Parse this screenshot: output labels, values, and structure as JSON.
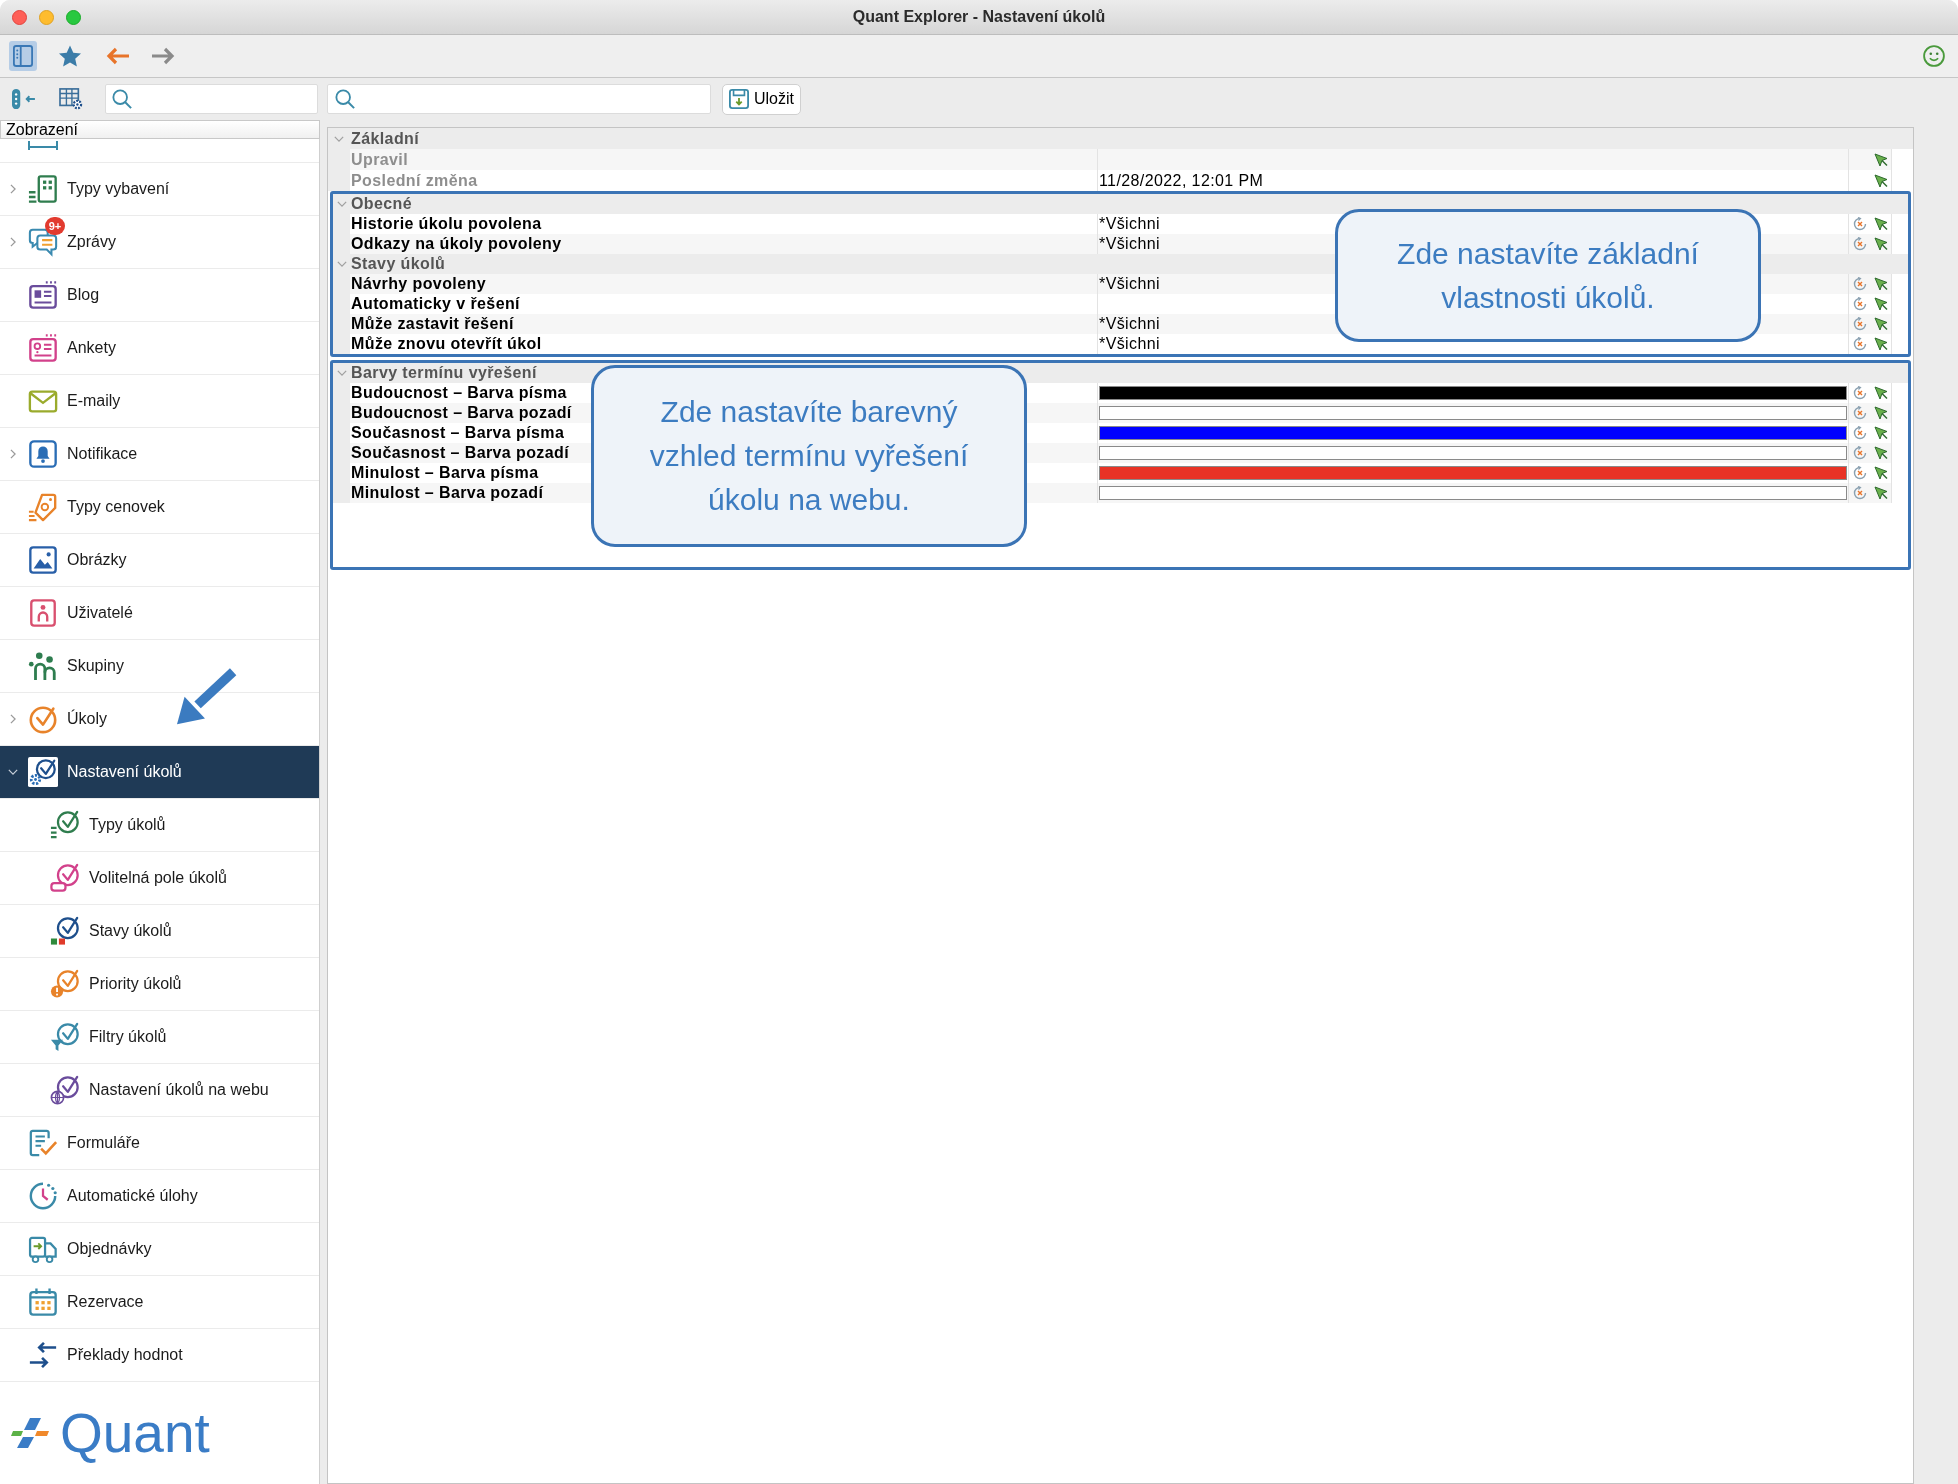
{
  "window": {
    "title": "Quant Explorer - Nastavení úkolů"
  },
  "toolbar": {
    "panel_toggle": {
      "selected": true
    }
  },
  "sidebar": {
    "header": "Zobrazení",
    "items": [
      {
        "label": "Typy vybavení",
        "expanded": false,
        "selected": false
      },
      {
        "label": "Zprávy",
        "expanded": false,
        "selected": false,
        "badge": "9+"
      },
      {
        "label": "Blog",
        "selected": false
      },
      {
        "label": "Ankety",
        "selected": false
      },
      {
        "label": "E-maily",
        "selected": false
      },
      {
        "label": "Notifikace",
        "expanded": false,
        "selected": false
      },
      {
        "label": "Typy cenovek",
        "selected": false
      },
      {
        "label": "Obrázky",
        "selected": false
      },
      {
        "label": "Uživatelé",
        "selected": false
      },
      {
        "label": "Skupiny",
        "selected": false
      },
      {
        "label": "Úkoly",
        "expanded": false,
        "selected": false
      },
      {
        "label": "Nastavení úkolů",
        "expanded": true,
        "selected": true,
        "children": [
          {
            "label": "Typy úkolů",
            "selected": false
          },
          {
            "label": "Volitelná pole úkolů",
            "selected": false
          },
          {
            "label": "Stavy úkolů",
            "selected": false
          },
          {
            "label": "Priority úkolů",
            "selected": false
          },
          {
            "label": "Filtry úkolů",
            "selected": false
          },
          {
            "label": "Nastavení úkolů na webu",
            "selected": false
          }
        ]
      },
      {
        "label": "Formuláře",
        "selected": false
      },
      {
        "label": "Automatické úlohy",
        "selected": false
      },
      {
        "label": "Objednávky",
        "selected": false
      },
      {
        "label": "Rezervace",
        "selected": false
      },
      {
        "label": "Překlady hodnot",
        "selected": false
      }
    ],
    "logo": "Quant"
  },
  "main": {
    "save_button": "Uložit"
  },
  "properties": {
    "sections": [
      {
        "highlighted": false,
        "groups": [
          {
            "title": "Základní",
            "expanded": true,
            "rows": [
              {
                "kind": "text",
                "label": "Upravil",
                "disabled": true,
                "resettable": false
              },
              {
                "kind": "text",
                "label": "Poslední změna",
                "value": "11/28/2022, 12:01 PM",
                "disabled": true,
                "resettable": false
              }
            ]
          }
        ]
      },
      {
        "highlighted": true,
        "callout_lines": [
          "Zde nastavíte základní",
          "vlastnosti úkolů."
        ],
        "groups": [
          {
            "title": "Obecné",
            "expanded": true,
            "rows": [
              {
                "kind": "text",
                "label": "Historie úkolu povolena",
                "value": "*Všichni",
                "disabled": false,
                "resettable": true
              },
              {
                "kind": "text",
                "label": "Odkazy na úkoly povoleny",
                "value": "*Všichni",
                "disabled": false,
                "resettable": true
              }
            ]
          },
          {
            "title": "Stavy úkolů",
            "expanded": true,
            "rows": [
              {
                "kind": "text",
                "label": "Návrhy povoleny",
                "value": "*Všichni",
                "disabled": false,
                "resettable": true
              },
              {
                "kind": "text",
                "label": "Automaticky v řešení",
                "disabled": false,
                "resettable": true
              },
              {
                "kind": "text",
                "label": "Může zastavit řešení",
                "value": "*Všichni",
                "disabled": false,
                "resettable": true
              },
              {
                "kind": "text",
                "label": "Může znovu otevřít úkol",
                "value": "*Všichni",
                "disabled": false,
                "resettable": true
              }
            ]
          }
        ]
      },
      {
        "highlighted": true,
        "callout_lines": [
          "Zde nastavíte barevný",
          "vzhled termínu vyřešení",
          "úkolu na webu."
        ],
        "groups": [
          {
            "title": "Barvy termínu vyřešení",
            "expanded": true,
            "rows": [
              {
                "kind": "color",
                "label": "Budoucnost – Barva písma",
                "color": "#000000",
                "disabled": false,
                "resettable": true
              },
              {
                "kind": "color",
                "label": "Budoucnost – Barva pozadí",
                "color": "#ffffff",
                "disabled": false,
                "resettable": true
              },
              {
                "kind": "color",
                "label": "Současnost – Barva písma",
                "color": "#0000ff",
                "disabled": false,
                "resettable": true
              },
              {
                "kind": "color",
                "label": "Současnost – Barva pozadí",
                "color": "#ffffff",
                "disabled": false,
                "resettable": true
              },
              {
                "kind": "color",
                "label": "Minulost – Barva písma",
                "color": "#e83326",
                "disabled": false,
                "resettable": true
              },
              {
                "kind": "color",
                "label": "Minulost – Barva pozadí",
                "color": "#ffffff",
                "disabled": false,
                "resettable": true
              }
            ]
          }
        ]
      }
    ]
  }
}
